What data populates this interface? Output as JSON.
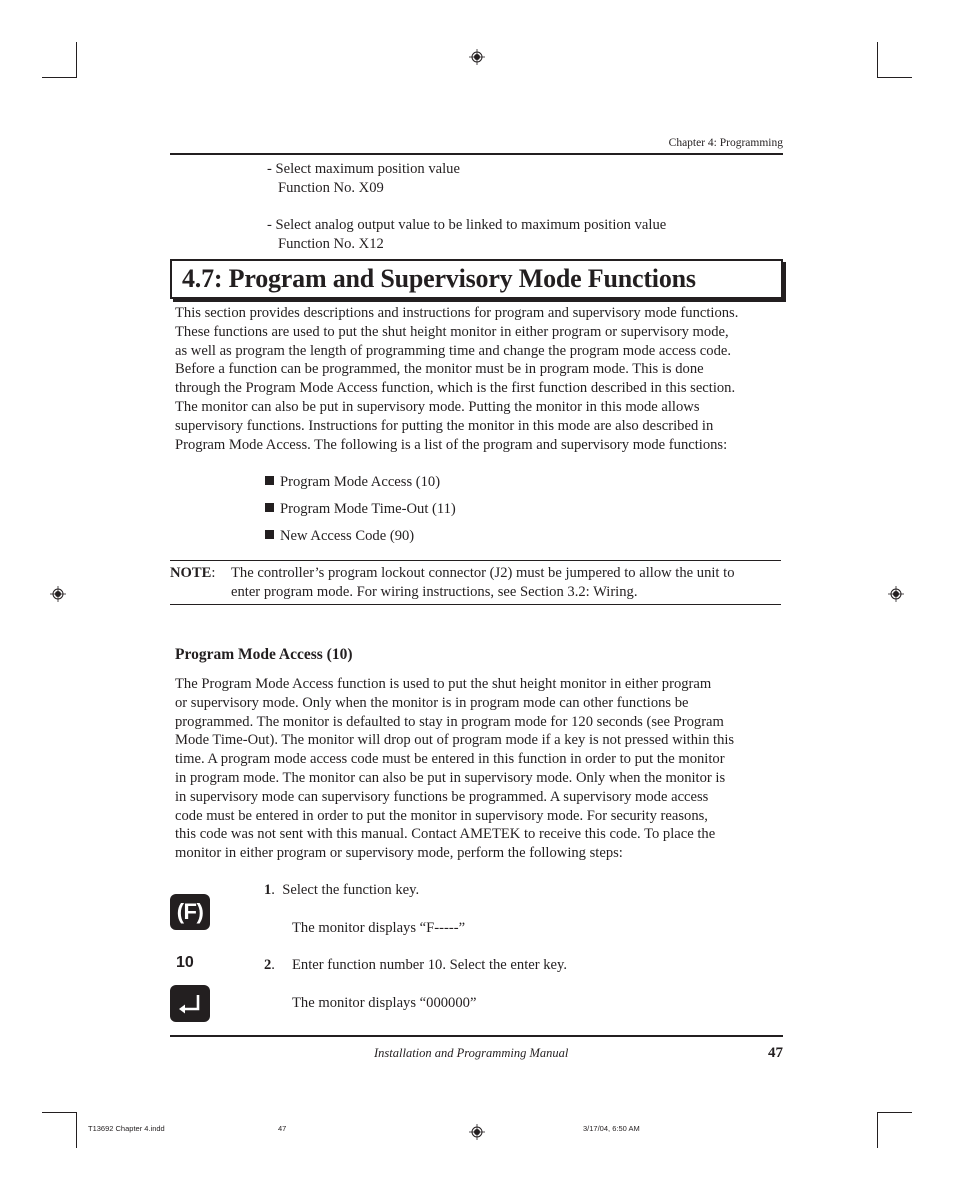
{
  "header": {
    "running_head": "Chapter 4:  Programming"
  },
  "intro_items": [
    {
      "line1": "-  Select maximum position value",
      "line2": "Function No. X09"
    },
    {
      "line1": "-  Select analog output value to be linked to maximum position value",
      "line2": "Function No. X12"
    }
  ],
  "section": {
    "title": "4.7:  Program and Supervisory Mode Functions",
    "paragraph_lines": [
      "This section provides descriptions and instructions for program and supervisory mode functions.",
      "These functions are used to put the shut height monitor in either program or supervisory mode,",
      "as well as program the length of programming time and change the program mode access code.",
      "Before a function can be programmed, the monitor must be in program mode. This is done",
      "through the Program Mode Access function, which is the first function described in this section.",
      "The monitor can also be put in supervisory mode. Putting the monitor in this mode allows",
      "supervisory functions. Instructions for putting the monitor in this mode are also described in",
      "Program Mode Access. The following is a list of the program and supervisory mode functions:"
    ],
    "function_list": [
      "Program Mode Access (10)",
      "Program Mode Time-Out (11)",
      "New Access Code (90)"
    ]
  },
  "note": {
    "label": "NOTE",
    "colon": ":",
    "line1": "The controller’s program lockout connector (J2) must be jumpered to allow the unit to",
    "line2": "enter program mode. For wiring instructions, see Section 3.2:  Wiring."
  },
  "subsection": {
    "title": "Program Mode Access (10)",
    "paragraph_lines": [
      "The Program Mode Access function is used to put the shut height monitor in either program",
      "or supervisory mode. Only when the monitor is in program mode can other functions be",
      "programmed. The monitor is defaulted to stay in program mode for 120 seconds (see Program",
      "Mode Time-Out). The monitor will drop out of program mode if a key is not pressed within this",
      "time. A program mode access code must be entered in this function in order to put the monitor",
      "in program mode. The monitor can also be put in supervisory mode. Only when the monitor is",
      "in supervisory mode can supervisory functions be programmed.  A supervisory mode access",
      "code must be entered in order to put the monitor in supervisory mode. For security reasons,",
      "this code was not sent with this manual. Contact AMETEK to receive this code. To place the",
      "monitor in either program or supervisory mode, perform the following steps:"
    ]
  },
  "steps": [
    {
      "number": "1",
      "sep": ".  ",
      "text": "Select the function key.",
      "result": "The monitor displays “F-----”"
    },
    {
      "number": "2",
      "sep": ".",
      "text": "Enter function number 10. Select the enter key.",
      "result": "The monitor displays “000000”"
    }
  ],
  "keys": {
    "function_key_label": "(F)",
    "number_entry": "10",
    "enter_key_icon": "enter-arrow"
  },
  "footer": {
    "manual_title": "Installation and Programming Manual",
    "page_number": "47"
  },
  "slug": {
    "file_name": "T13692 Chapter 4.indd",
    "page": "47",
    "timestamp": "3/17/04, 6:50 AM"
  }
}
